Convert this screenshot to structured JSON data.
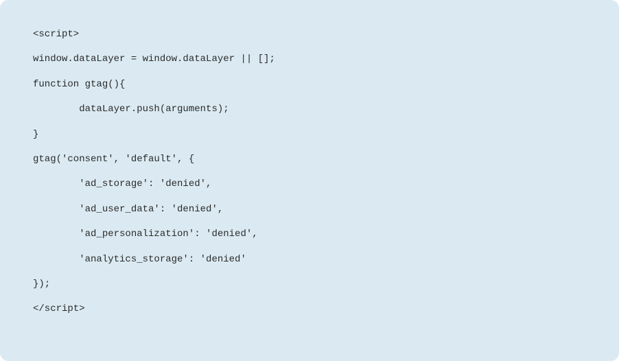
{
  "code": {
    "lines": [
      "<script>",
      "window.dataLayer = window.dataLayer || [];",
      "function gtag(){",
      "        dataLayer.push(arguments);",
      "}",
      "gtag('consent', 'default', {",
      "        'ad_storage': 'denied',",
      "        'ad_user_data': 'denied',",
      "        'ad_personalization': 'denied',",
      "        'analytics_storage': 'denied'",
      "});",
      "</script>"
    ]
  }
}
